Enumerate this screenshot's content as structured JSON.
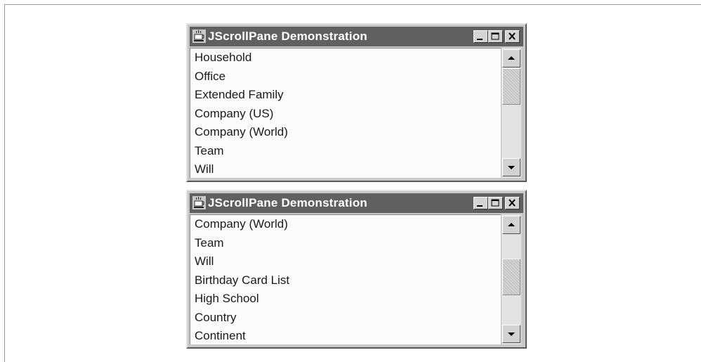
{
  "windows": [
    {
      "title": "JScrollPane Demonstration",
      "items": [
        "Household",
        "Office",
        "Extended Family",
        "Company (US)",
        "Company (World)",
        "Team",
        "Will"
      ],
      "scroll_fraction": 0.0
    },
    {
      "title": "JScrollPane Demonstration",
      "items": [
        "Company (World)",
        "Team",
        "Will",
        "Birthday Card List",
        "High School",
        "Country",
        "Continent"
      ],
      "scroll_fraction": 0.45
    }
  ],
  "icons": {
    "app": "coffee-cup-icon",
    "minimize": "minimize-icon",
    "maximize": "maximize-icon",
    "close": "close-icon",
    "scroll_up": "arrow-up-icon",
    "scroll_down": "arrow-down-icon"
  },
  "colors": {
    "titlebar": "#606060",
    "window_frame": "#c8c8c8",
    "list_background": "#fbfbfb"
  }
}
